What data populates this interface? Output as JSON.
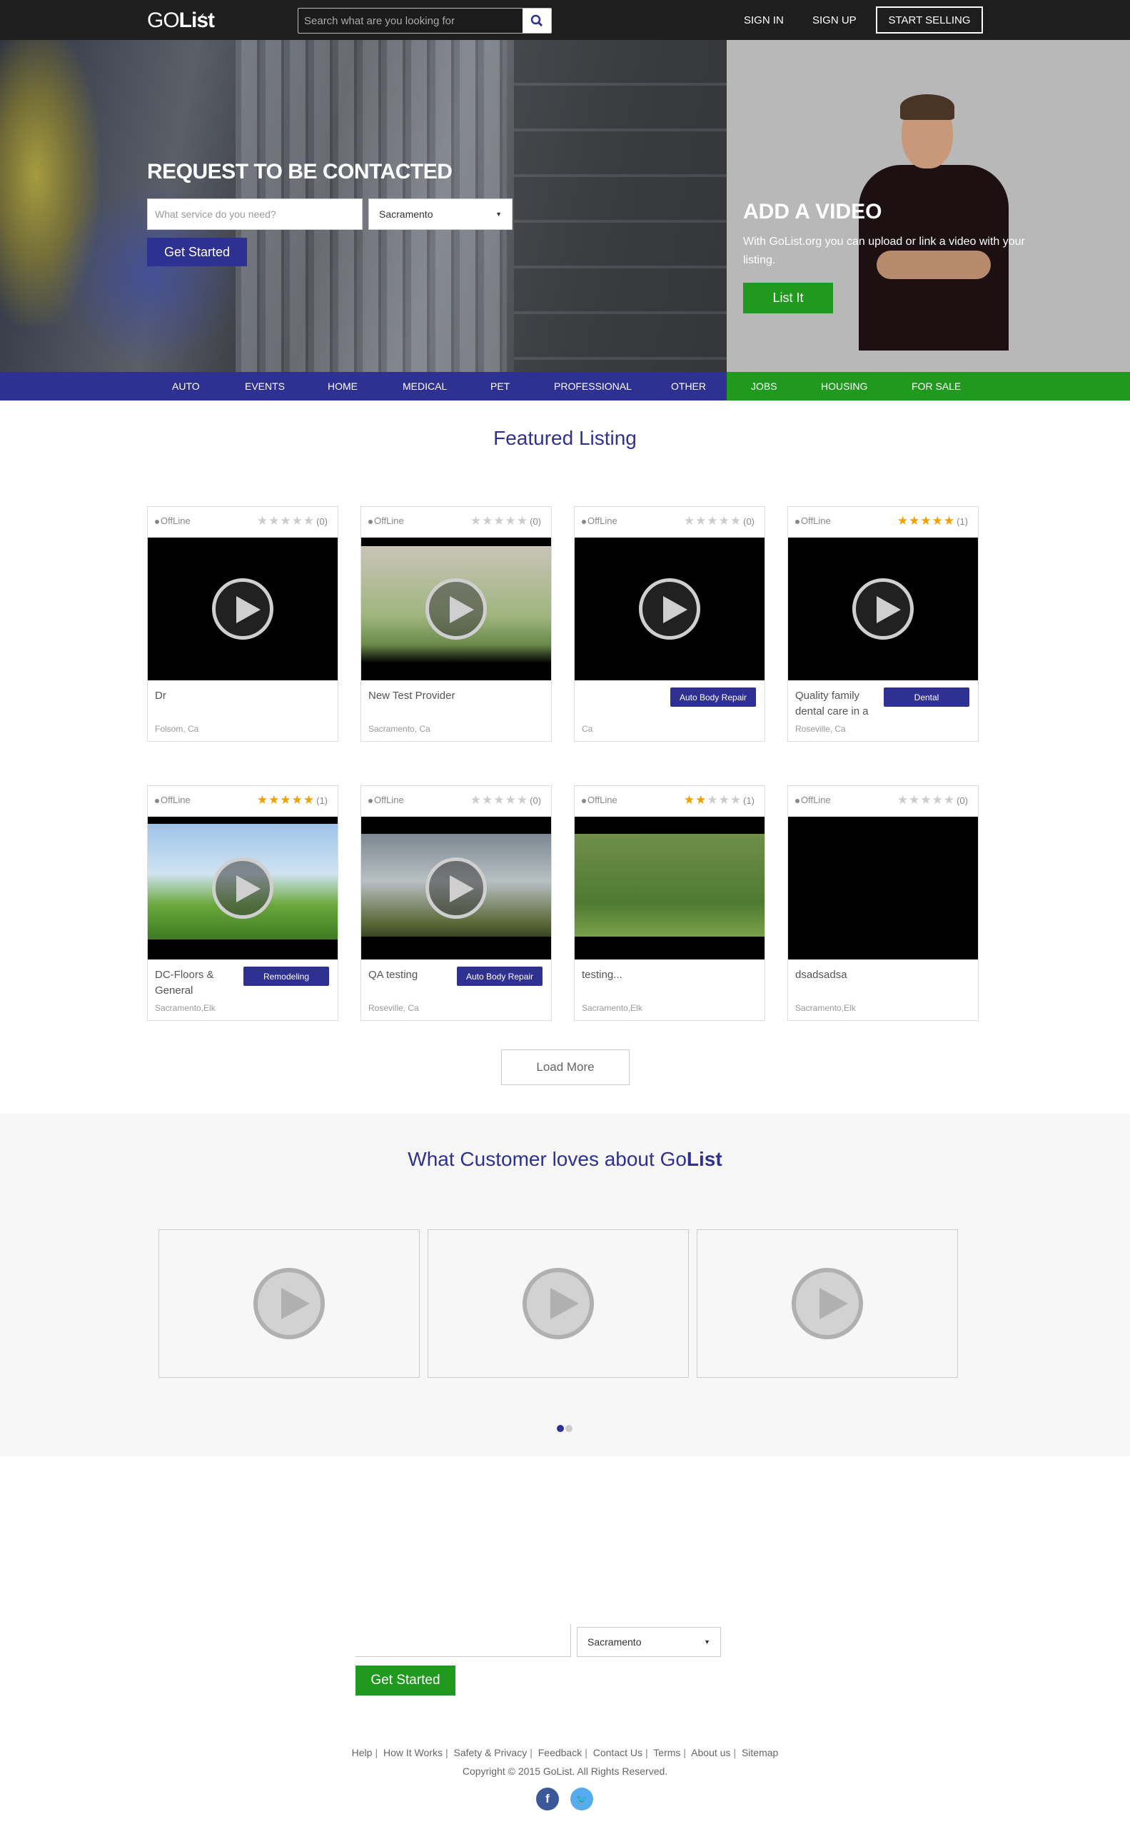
{
  "header": {
    "logo_go": "GO",
    "logo_list": "List",
    "search_placeholder": "Search what are you looking for",
    "sign_in": "SIGN IN",
    "sign_up": "SIGN UP",
    "start_selling": "START SELLING"
  },
  "hero": {
    "request_title": "REQUEST TO BE CONTACTED",
    "service_placeholder": "What service do you need?",
    "city": "Sacramento",
    "get_started": "Get Started",
    "add_video_title": "ADD A VIDEO",
    "add_video_desc": "With GoList.org you can upload or link a video with your listing.",
    "list_it": "List It"
  },
  "categories": {
    "blue": [
      "AUTO",
      "EVENTS",
      "HOME",
      "MEDICAL",
      "PET",
      "PROFESSIONAL",
      "OTHER"
    ],
    "green": [
      "JOBS",
      "HOUSING",
      "FOR SALE"
    ]
  },
  "featured": {
    "title": "Featured Listing",
    "status_label": "OffLine",
    "cards": [
      {
        "rating": 0,
        "count": "(0)",
        "title": "Dr",
        "location": "Folsom, Ca",
        "tag": "",
        "media": "video-black"
      },
      {
        "rating": 0,
        "count": "(0)",
        "title": "New Test Provider",
        "location": "Sacramento, Ca",
        "tag": "",
        "media": "girl-photo"
      },
      {
        "rating": 0,
        "count": "(0)",
        "title": "",
        "location": "Ca",
        "tag": "Auto Body Repair",
        "media": "video-black"
      },
      {
        "rating": 5,
        "count": "(1)",
        "title": "Quality family dental care in a",
        "location": "Roseville, Ca",
        "tag": "Dental",
        "media": "video-black"
      },
      {
        "rating": 5,
        "count": "(1)",
        "title": "DC-Floors & General",
        "location": "Sacramento,Elk",
        "tag": "Remodeling",
        "media": "cartoon"
      },
      {
        "rating": 0,
        "count": "(0)",
        "title": "QA testing",
        "location": "Roseville, Ca",
        "tag": "Auto Body Repair",
        "media": "landscape"
      },
      {
        "rating": 2,
        "count": "(1)",
        "title": "testing...",
        "location": "Sacramento,Elk",
        "tag": "",
        "media": "grass"
      },
      {
        "rating": 0,
        "count": "(0)",
        "title": "dsadsadsa",
        "location": "Sacramento,Elk",
        "tag": "",
        "media": "blank"
      }
    ],
    "load_more": "Load More"
  },
  "testimonials": {
    "title_prefix": "What Customer loves about Go",
    "title_brand": "List"
  },
  "bottom_form": {
    "city": "Sacramento",
    "get_started": "Get Started"
  },
  "footer": {
    "links": [
      "Help",
      "How It Works",
      "Safety & Privacy",
      "Feedback",
      "Contact Us",
      "Terms",
      "About us",
      "Sitemap"
    ],
    "copyright": "Copyright © 2015 GoList. All Rights Reserved."
  },
  "colors": {
    "brand_blue": "#2e3192",
    "brand_green": "#1f9a1f",
    "star": "#f0a000"
  }
}
